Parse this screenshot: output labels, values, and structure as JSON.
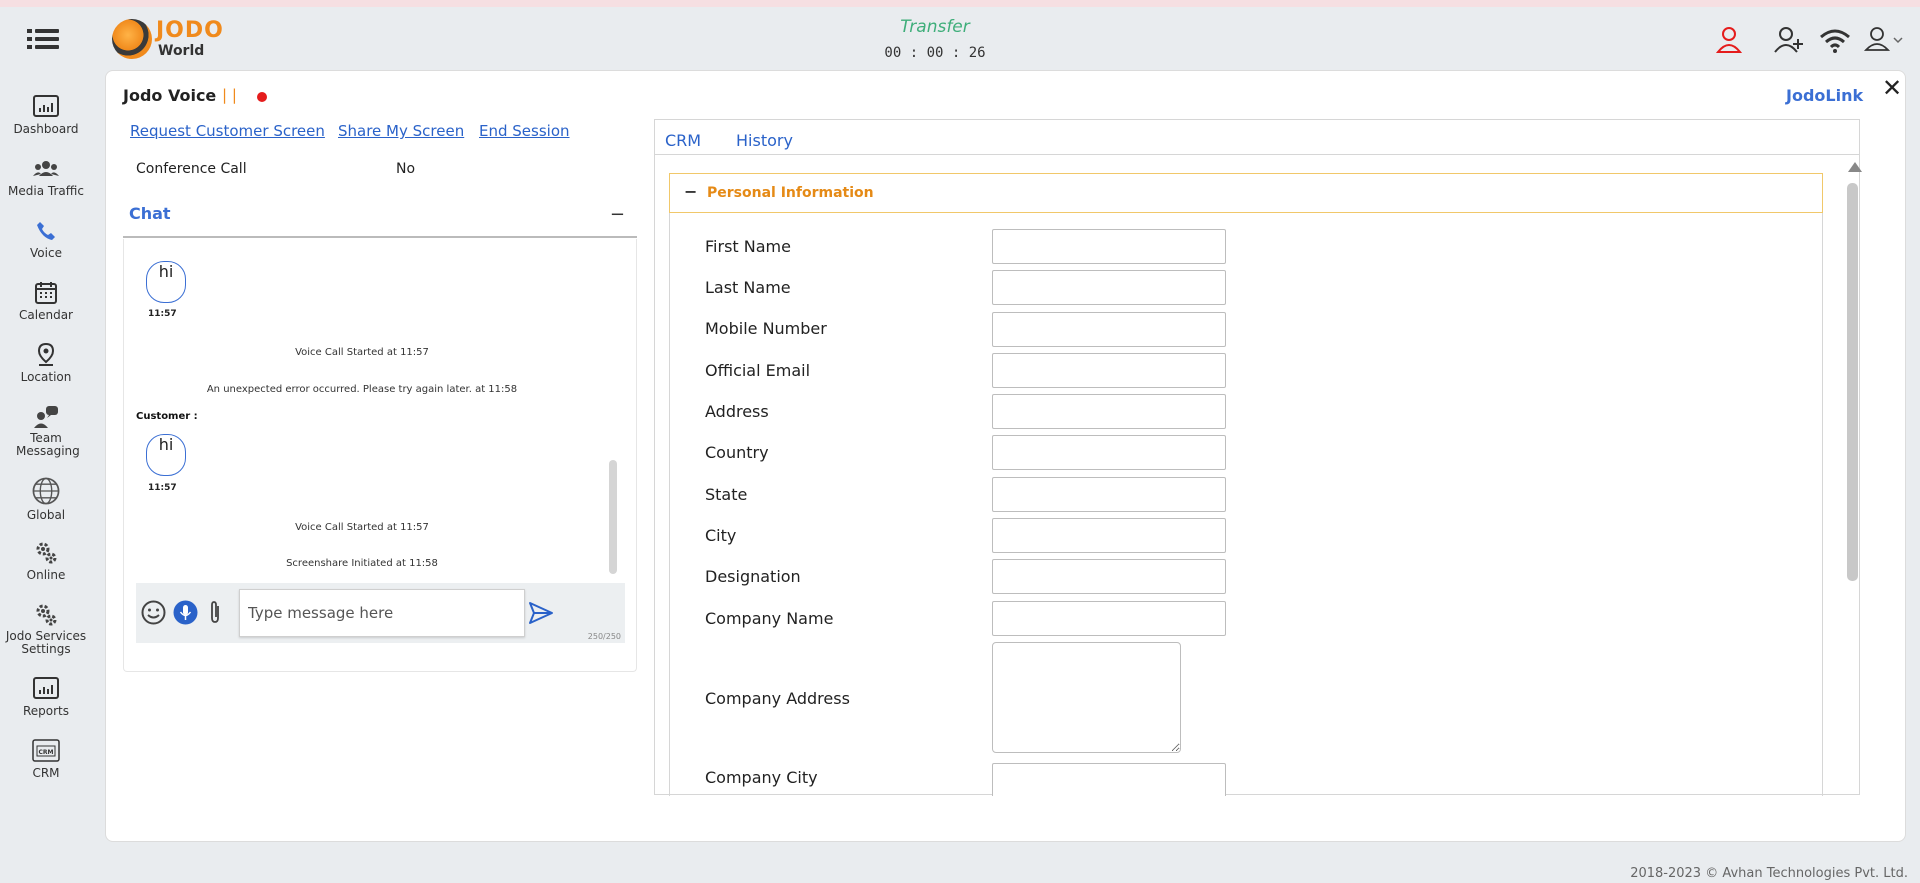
{
  "header": {
    "logo_main": "JODO",
    "logo_sub": "World",
    "status": "Transfer",
    "timer": "00 : 00 : 26"
  },
  "sidebar": {
    "items": [
      {
        "label": "Dashboard",
        "icon": "dashboard-icon"
      },
      {
        "label": "Media Traffic",
        "icon": "people-icon"
      },
      {
        "label": "Voice",
        "icon": "phone-icon"
      },
      {
        "label": "Calendar",
        "icon": "calendar-icon"
      },
      {
        "label": "Location",
        "icon": "location-pin-icon"
      },
      {
        "label": "Team Messaging",
        "icon": "team-chat-icon"
      },
      {
        "label": "Global",
        "icon": "globe-icon"
      },
      {
        "label": "Online",
        "icon": "gears-icon"
      },
      {
        "label": "Jodo Services Settings",
        "icon": "settings-gears-icon"
      },
      {
        "label": "Reports",
        "icon": "report-icon"
      },
      {
        "label": "CRM",
        "icon": "crm-icon"
      }
    ]
  },
  "session": {
    "title": "Jodo Voice",
    "pipes": "| |",
    "brand_link": "JodoLink",
    "links": [
      "Request Customer Screen",
      "Share My Screen",
      "End Session"
    ],
    "conference_label": "Conference Call",
    "conference_value": "No"
  },
  "chat": {
    "title": "Chat",
    "minimize": "−",
    "messages": [
      {
        "text": "hi",
        "time": "11:57"
      },
      {
        "system": "Voice Call Started at 11:57"
      },
      {
        "system": "An unexpected error occurred. Please try again later. at 11:58"
      },
      {
        "sender": "Customer :"
      },
      {
        "text": "hi",
        "time": "11:57"
      },
      {
        "system": "Voice Call Started at 11:57"
      },
      {
        "system": "Screenshare Initiated at 11:58"
      }
    ],
    "input_placeholder": "Type message here",
    "counter": "250/250"
  },
  "crm": {
    "tabs": [
      "CRM",
      "History"
    ],
    "section_toggle": "−",
    "section_title": "Personal Information",
    "fields": [
      {
        "label": "First Name",
        "value": ""
      },
      {
        "label": "Last Name",
        "value": ""
      },
      {
        "label": "Mobile Number",
        "value": ""
      },
      {
        "label": "Official Email",
        "value": ""
      },
      {
        "label": "Address",
        "value": ""
      },
      {
        "label": "Country",
        "value": ""
      },
      {
        "label": "State",
        "value": ""
      },
      {
        "label": "City",
        "value": ""
      },
      {
        "label": "Designation",
        "value": ""
      },
      {
        "label": "Company Name",
        "value": ""
      },
      {
        "label": "Company Address",
        "value": ""
      },
      {
        "label": "Company City",
        "value": ""
      }
    ]
  },
  "footer": {
    "copyright": "2018-2023 © Avhan Technologies Pvt. Ltd."
  },
  "colors": {
    "accent_blue": "#2a62c9",
    "accent_orange": "#e58a16",
    "status_green": "#3fae7a",
    "alert_red": "#e51c1c"
  }
}
